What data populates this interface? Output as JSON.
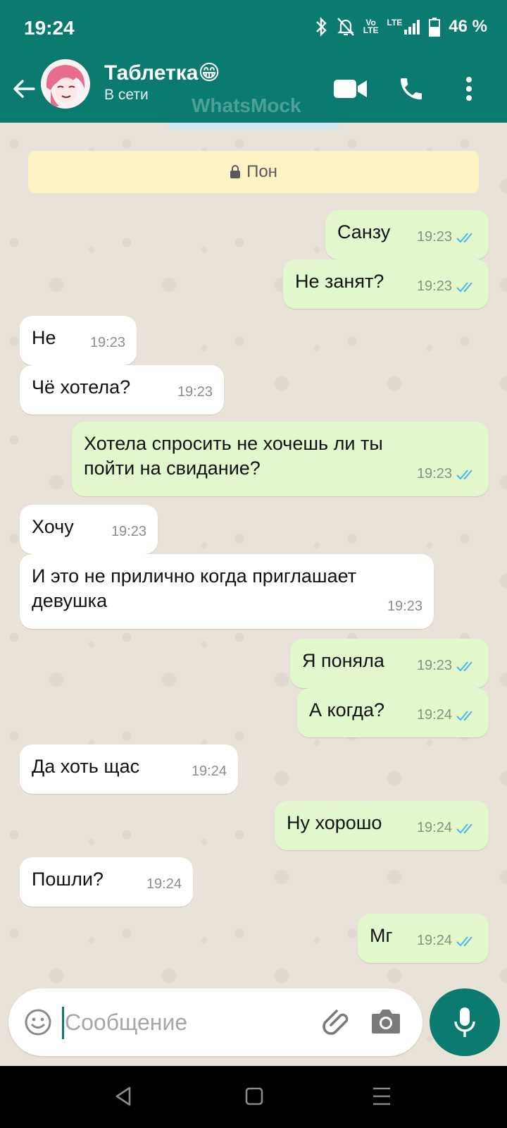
{
  "status_bar": {
    "time": "19:24",
    "network_top": "Vo",
    "network_bottom": "LTE",
    "lte": "LTE",
    "battery": "46 %"
  },
  "header": {
    "title": "Таблетка😁",
    "subtitle": "В сети",
    "watermark": "WhatsMock"
  },
  "chat": {
    "date_banner": "Пон",
    "messages": [
      {
        "direction": "out",
        "text": "Санзу",
        "time": "19:23"
      },
      {
        "direction": "out",
        "text": "Не занят?",
        "time": "19:23"
      },
      {
        "direction": "in",
        "text": "Не",
        "time": "19:23"
      },
      {
        "direction": "in",
        "text": "Чё хотела?",
        "time": "19:23"
      },
      {
        "direction": "out",
        "text_line1": "Хотела спросить не хочешь ли ты",
        "text_line2": "пойти на свидание?",
        "time": "19:23"
      },
      {
        "direction": "in",
        "text": "Хочу",
        "time": "19:23"
      },
      {
        "direction": "in",
        "text_line1": "И это не прилично когда приглашает",
        "text_line2": "девушка",
        "time": "19:23"
      },
      {
        "direction": "out",
        "text": "Я поняла",
        "time": "19:23"
      },
      {
        "direction": "out",
        "text": "А когда?",
        "time": "19:24"
      },
      {
        "direction": "in",
        "text": "Да хоть щас",
        "time": "19:24"
      },
      {
        "direction": "out",
        "text": "Ну хорошо",
        "time": "19:24"
      },
      {
        "direction": "in",
        "text": "Пошли?",
        "time": "19:24"
      },
      {
        "direction": "out",
        "text": "Мг",
        "time": "19:24"
      }
    ]
  },
  "composer": {
    "placeholder": "Сообщение"
  },
  "colors": {
    "header": "#0b7a6f",
    "outgoing_bubble": "#e2f7cb",
    "incoming_bubble": "#ffffff",
    "read_ticks": "#4fb6ec"
  },
  "icons": [
    "back-arrow-icon",
    "video-call-icon",
    "phone-icon",
    "more-vert-icon",
    "lock-icon",
    "emoji-icon",
    "attach-icon",
    "camera-icon",
    "mic-icon",
    "double-check-icon"
  ]
}
